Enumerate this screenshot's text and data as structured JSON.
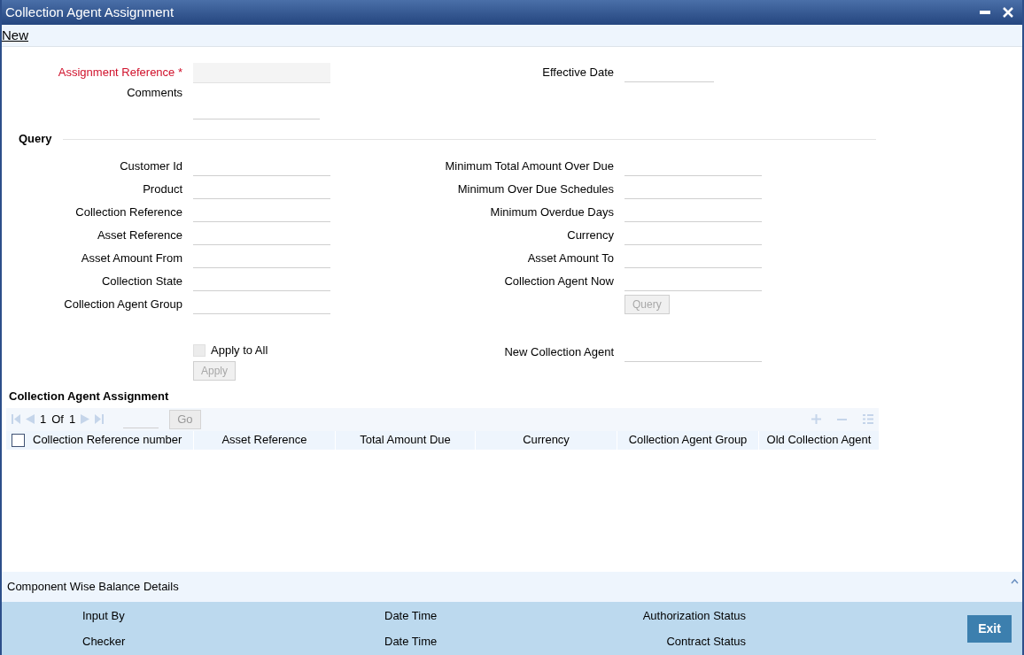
{
  "window": {
    "title": "Collection Agent Assignment"
  },
  "toolbar": {
    "new_link": "New"
  },
  "header_fields": {
    "required_mark": "*",
    "left": [
      {
        "label": "Assignment Reference",
        "required": true,
        "kind": "shaded"
      },
      {
        "label": "Comments",
        "required": false,
        "kind": "textarea"
      }
    ],
    "right": [
      {
        "label": "Effective Date",
        "required": false,
        "kind": "short"
      }
    ]
  },
  "query": {
    "title": "Query",
    "left": [
      {
        "label": "Customer Id"
      },
      {
        "label": "Product"
      },
      {
        "label": "Collection Reference"
      },
      {
        "label": "Asset Reference"
      },
      {
        "label": "Asset Amount From"
      },
      {
        "label": "Collection State"
      },
      {
        "label": "Collection Agent Group"
      }
    ],
    "right": [
      {
        "label": "Minimum Total Amount Over Due"
      },
      {
        "label": "Minimum Over Due Schedules"
      },
      {
        "label": "Minimum Overdue Days"
      },
      {
        "label": "Currency"
      },
      {
        "label": "Asset Amount To"
      },
      {
        "label": "Collection Agent Now"
      }
    ],
    "button": {
      "label": "Query",
      "disabled": true
    }
  },
  "apply_to_all": {
    "label": "Apply to All",
    "checked": false
  },
  "apply_button": {
    "label": "Apply",
    "disabled": true
  },
  "new_agent": {
    "label": "New Collection Agent"
  },
  "grid": {
    "title": "Collection Agent Assignment",
    "page": "1",
    "of": "Of",
    "total": "1",
    "go": "Go",
    "select_all_checked": false,
    "columns": [
      "Collection Reference number",
      "Asset Reference",
      "Total Amount Due",
      "Currency",
      "Collection Agent Group",
      "Old Collection Agent"
    ]
  },
  "section": {
    "title": "Component Wise Balance Details",
    "expanded": true
  },
  "audit": [
    [
      "Input By",
      "Checker"
    ],
    [
      "Date Time",
      "Date Time"
    ],
    [
      "Authorization Status",
      "Contract Status"
    ]
  ],
  "exit_button": "Exit"
}
